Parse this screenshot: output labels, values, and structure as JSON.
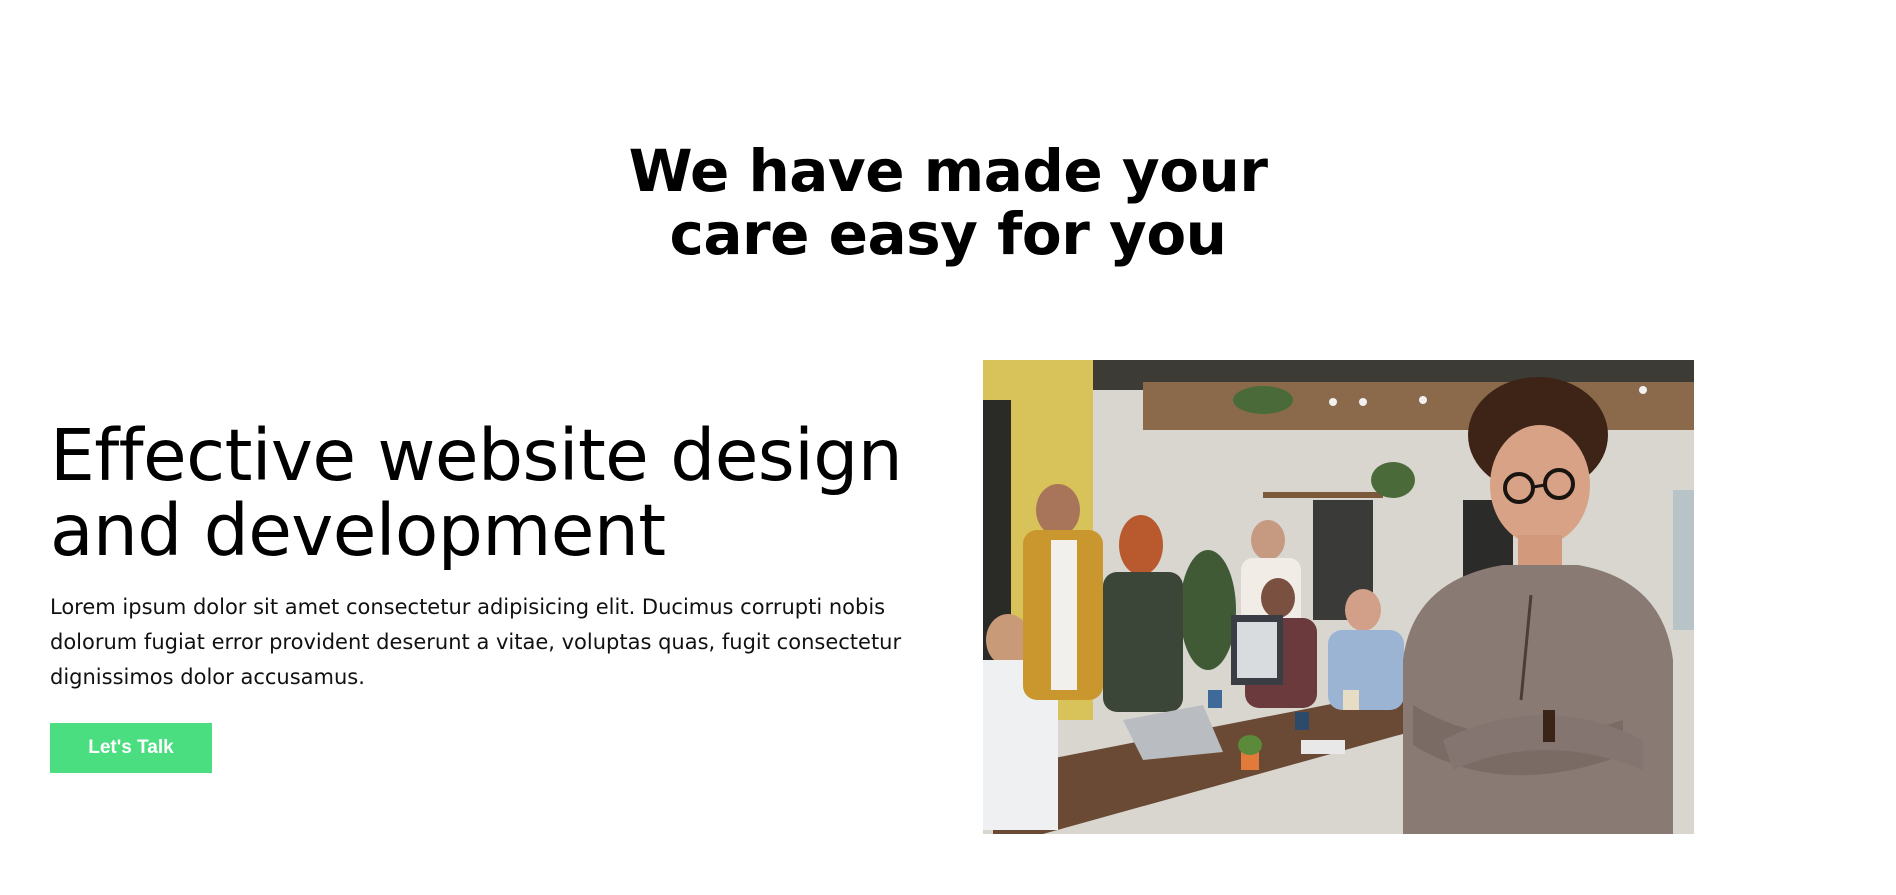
{
  "section": {
    "heading_line1": "We have made your",
    "heading_line2": "care easy for you"
  },
  "hero": {
    "title_line1": "Effective website design",
    "title_line2": "and development",
    "description": "Lorem ipsum dolor sit amet consectetur adipisicing elit. Ducimus corrupti nobis dolorum fugiat error provident deserunt a vitae, voluptas quas, fugit consectetur dignissimos dolor accusamus.",
    "cta_label": "Let's Talk"
  },
  "colors": {
    "accent": "#4ade80",
    "text": "#000000",
    "background": "#ffffff"
  }
}
